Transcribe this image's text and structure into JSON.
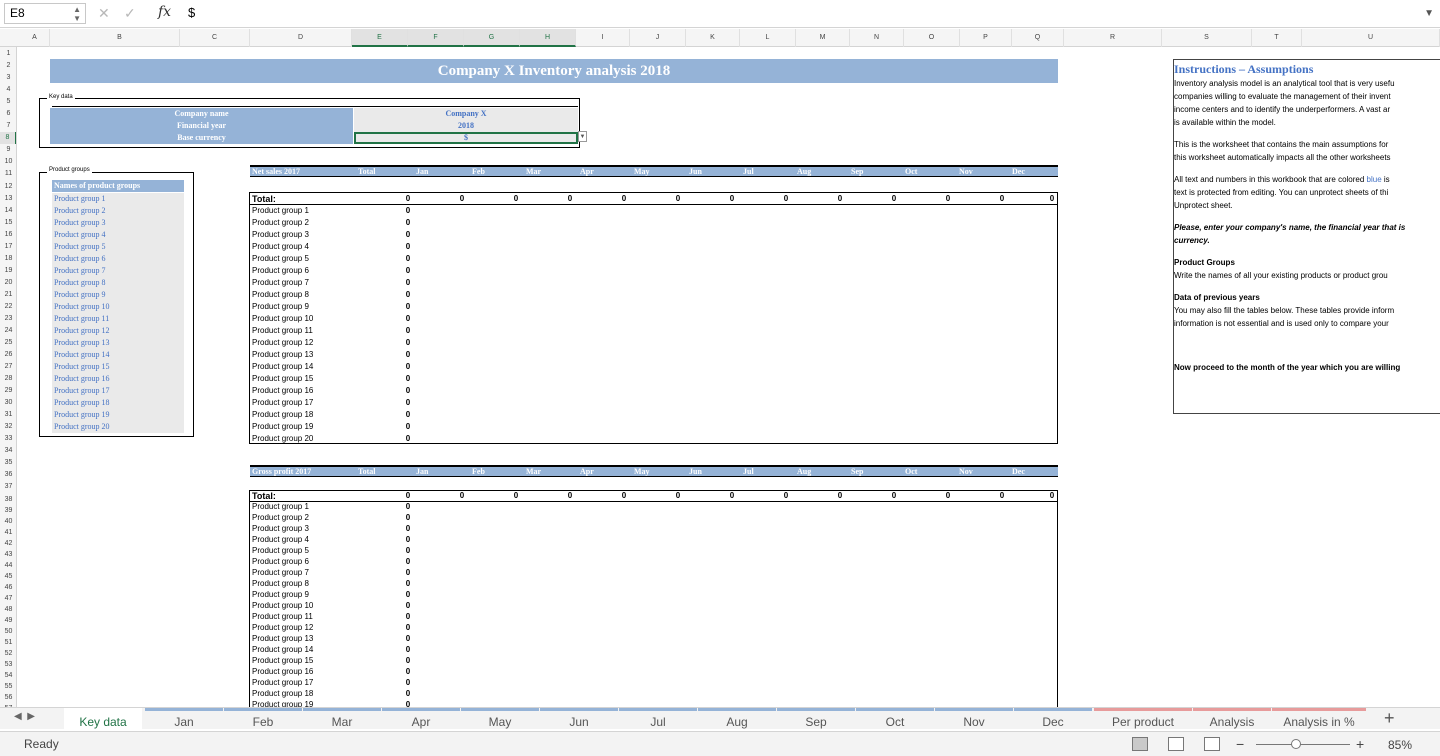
{
  "formula": {
    "cell_ref": "E8",
    "fx": "fx",
    "value": "$"
  },
  "columns": [
    "A",
    "B",
    "C",
    "D",
    "E",
    "F",
    "G",
    "H",
    "I",
    "J",
    "K",
    "L",
    "M",
    "N",
    "O",
    "P",
    "Q",
    "R",
    "S",
    "T",
    "U"
  ],
  "rows": [
    "1",
    "2",
    "3",
    "4",
    "5",
    "6",
    "7",
    "8",
    "9",
    "10",
    "11",
    "12",
    "13",
    "14",
    "15",
    "16",
    "17",
    "18",
    "19",
    "20",
    "21",
    "22",
    "23",
    "24",
    "25",
    "26",
    "27",
    "28",
    "29",
    "30",
    "31",
    "32",
    "33",
    "34",
    "35",
    "36",
    "37",
    "38",
    "39",
    "40",
    "41",
    "42",
    "43",
    "44",
    "45",
    "46",
    "47",
    "48",
    "49",
    "50",
    "51",
    "52",
    "53",
    "54",
    "55",
    "56",
    "57"
  ],
  "title": "Company X Inventory analysis 2018",
  "key_data": {
    "group_title": "Key data",
    "labels": [
      "Company name",
      "Financial year",
      "Base currency"
    ],
    "values": [
      "Company X",
      "2018",
      "$"
    ]
  },
  "product_groups": {
    "group_title": "Product groups",
    "header": "Names of product groups",
    "items": [
      "Product group 1",
      "Product group 2",
      "Product group 3",
      "Product group 4",
      "Product group 5",
      "Product group 6",
      "Product group 7",
      "Product group 8",
      "Product group 9",
      "Product group 10",
      "Product group 11",
      "Product group 12",
      "Product group 13",
      "Product group 14",
      "Product group 15",
      "Product group 16",
      "Product group 17",
      "Product group 18",
      "Product group 19",
      "Product group 20"
    ]
  },
  "months": [
    "Jan",
    "Feb",
    "Mar",
    "Apr",
    "May",
    "Jun",
    "Jul",
    "Aug",
    "Sep",
    "Oct",
    "Nov",
    "Dec"
  ],
  "table1": {
    "title": "Net sales 2017",
    "total_col": "Total",
    "total_row": "Total:",
    "zero": "0"
  },
  "table2": {
    "title": "Gross profit 2017",
    "total_col": "Total",
    "total_row": "Total:",
    "zero": "0",
    "visible_rows": [
      "Product group 1",
      "Product group 2",
      "Product group 3",
      "Product group 4",
      "Product group 5",
      "Product group 6",
      "Product group 7",
      "Product group 8",
      "Product group 9",
      "Product group 10",
      "Product group 11",
      "Product group 12",
      "Product group 13",
      "Product group 14",
      "Product group 15",
      "Product group 16",
      "Product group 17",
      "Product group 18",
      "Product group 19"
    ]
  },
  "instructions": {
    "title": "Instructions – Assumptions",
    "p1": [
      "Inventory analysis model is an analytical tool that is very usefu",
      "companies willing to evaluate the management of their invent",
      "income centers and to identify the underperformers. A vast ar",
      "is available within the model."
    ],
    "p2": [
      "This is the worksheet that contains the main assumptions for",
      "this worksheet automatically impacts all the other worksheets"
    ],
    "p3a": "All text and numbers in this workbook that are colored ",
    "p3blue": "blue",
    "p3b": " is",
    "p3rest": [
      "text is protected from editing. You can unprotect sheets of thi",
      "Unprotect sheet."
    ],
    "p4": [
      "Please, enter your company's name, the financial year that is",
      "currency."
    ],
    "p5h": "Product Groups",
    "p5": "Write the names of all your existing products or product grou",
    "p6h": "Data of previous years",
    "p6": [
      "You may also fill the tables below. These tables provide inform",
      "information is not essential and is used only to compare your"
    ],
    "p7": "Now proceed to the month of the year which you are willing"
  },
  "tabs": [
    "Key data",
    "Jan",
    "Feb",
    "Mar",
    "Apr",
    "May",
    "Jun",
    "Jul",
    "Aug",
    "Sep",
    "Oct",
    "Nov",
    "Dec",
    "Per product",
    "Analysis",
    "Analysis in %"
  ],
  "status": {
    "ready": "Ready",
    "zoom": "85%"
  }
}
